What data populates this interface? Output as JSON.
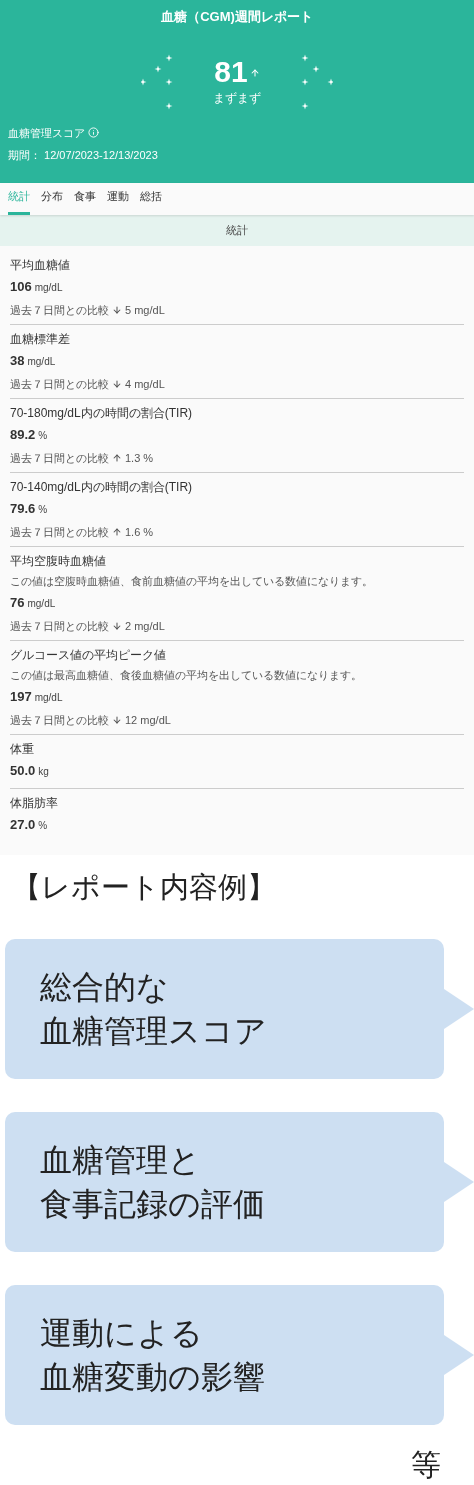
{
  "header": {
    "title": "血糖（CGM)週間レポート",
    "score": "81",
    "score_rising": true,
    "score_rating": "まずまず",
    "score_label": "血糖管理スコア",
    "period": "期間： 12/07/2023-12/13/2023"
  },
  "tabs": [
    {
      "label": "統計",
      "selected": true
    },
    {
      "label": "分布",
      "selected": false
    },
    {
      "label": "食事",
      "selected": false
    },
    {
      "label": "運動",
      "selected": false
    },
    {
      "label": "総括",
      "selected": false
    }
  ],
  "section_title": "統計",
  "stats": [
    {
      "title": "平均血糖値",
      "value": "106",
      "unit": "mg/dL",
      "comparison": {
        "label": "過去７日間との比較",
        "rising": false,
        "change": "5 mg/dL"
      }
    },
    {
      "title": "血糖標準差",
      "value": "38",
      "unit": "mg/dL",
      "comparison": {
        "label": "過去７日間との比較",
        "rising": false,
        "change": "4 mg/dL"
      }
    },
    {
      "title": "70-180mg/dL内の時間の割合(TIR)",
      "value": "89.2",
      "unit": "%",
      "comparison": {
        "label": "過去７日間との比較",
        "rising": true,
        "change": "1.3 %"
      }
    },
    {
      "title": "70-140mg/dL内の時間の割合(TIR)",
      "value": "79.6",
      "unit": "%",
      "comparison": {
        "label": "過去７日間との比較",
        "rising": true,
        "change": "1.6 %"
      }
    },
    {
      "title": "平均空腹時血糖値",
      "description": "この値は空腹時血糖値、食前血糖値の平均を出している数値になります。",
      "value": "76",
      "unit": "mg/dL",
      "comparison": {
        "label": "過去７日間との比較",
        "rising": false,
        "change": "2 mg/dL"
      }
    },
    {
      "title": "グルコース値の平均ピーク値",
      "description": "この値は最高血糖値、食後血糖値の平均を出している数値になります。",
      "value": "197",
      "unit": "mg/dL",
      "comparison": {
        "label": "過去７日間との比較",
        "rising": false,
        "change": "12 mg/dL"
      }
    },
    {
      "title": "体重",
      "value": "50.0",
      "unit": "kg"
    },
    {
      "title": "体脂肪率",
      "value": "27.0",
      "unit": "%"
    }
  ],
  "caption": "【レポート内容例】",
  "callouts": [
    {
      "lines": [
        "総合的な",
        "血糖管理スコア"
      ]
    },
    {
      "lines": [
        "血糖管理と",
        "食事記録の評価"
      ]
    },
    {
      "lines": [
        "運動による",
        "血糖変動の影響"
      ]
    }
  ],
  "footnote": "等"
}
